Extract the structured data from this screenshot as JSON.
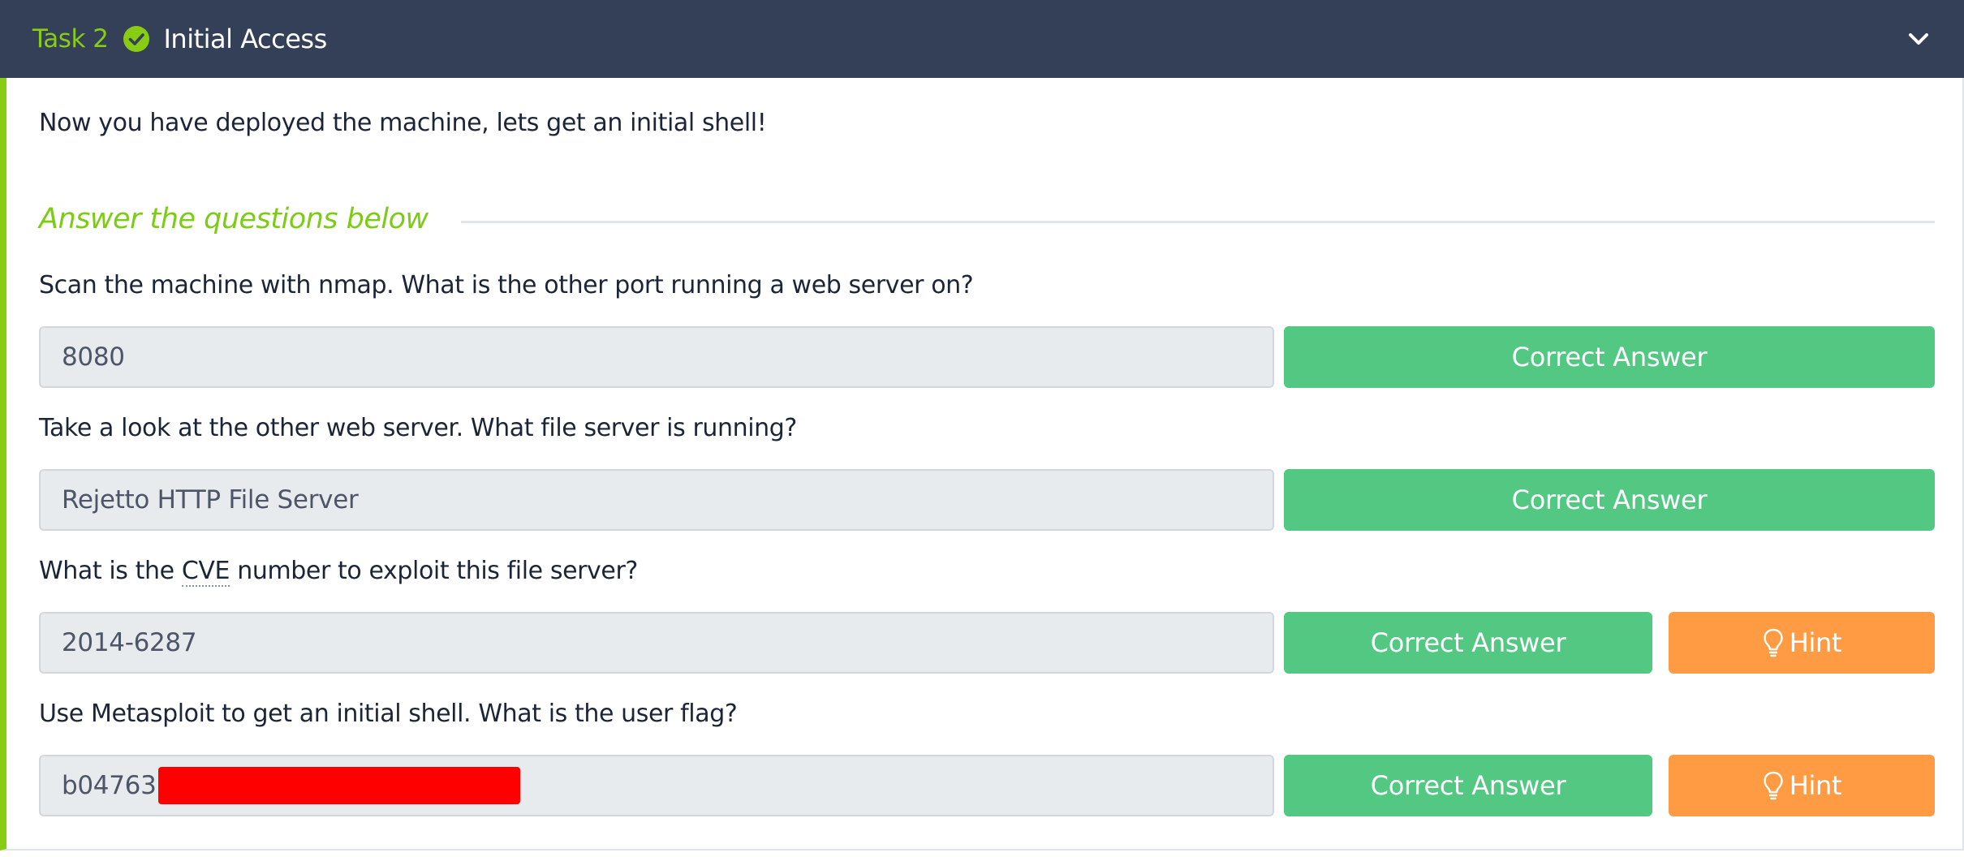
{
  "task": {
    "number_label": "Task 2",
    "title": "Initial Access",
    "accent_color": "#88cc14",
    "header_color": "#343f58"
  },
  "intro_text": "Now you have deployed the machine, lets get an initial shell!",
  "section_heading": "Answer the questions below",
  "questions": [
    {
      "text": "Scan the machine with nmap. What is the other port running a web server on?",
      "answer": "8080",
      "button_label": "Correct Answer"
    },
    {
      "text": "Take a look at the other web server. What file server is running?",
      "answer": "Rejetto HTTP File Server",
      "button_label": "Correct Answer"
    },
    {
      "text_before": "What is the ",
      "abbr": "CVE",
      "text_after": " number to exploit this file server?",
      "answer": "2014-6287",
      "button_label": "Correct Answer",
      "hint_label": "Hint"
    },
    {
      "text": "Use Metasploit to get an initial shell. What is the user flag?",
      "answer": "b04763",
      "button_label": "Correct Answer",
      "hint_label": "Hint"
    }
  ],
  "colors": {
    "correct_button": "#53c882",
    "hint_button": "#ff9b43",
    "redaction": "#ff0000"
  },
  "icons": {
    "task_status": "check-circle-icon",
    "collapse": "chevron-down-icon",
    "hint": "lightbulb-icon"
  }
}
